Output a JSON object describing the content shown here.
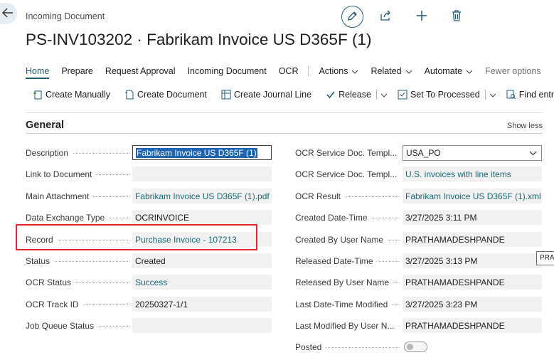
{
  "header": {
    "caption": "Incoming Document",
    "title": "PS-INV103202 · Fabrikam Invoice US D365F (1)"
  },
  "menu": {
    "items": [
      "Home",
      "Prepare",
      "Request Approval",
      "Incoming Document",
      "OCR"
    ],
    "dropdowns": [
      "Actions",
      "Related",
      "Automate"
    ],
    "fewer_options": "Fewer options"
  },
  "actions": {
    "create_manually": "Create Manually",
    "create_document": "Create Document",
    "create_journal_line": "Create Journal Line",
    "release": "Release",
    "set_to_processed": "Set To Processed",
    "find_entries": "Find entries..."
  },
  "section": {
    "title": "General",
    "toggle_label": "Show less"
  },
  "left_fields": [
    {
      "label": "Description",
      "value": "Fabrikam Invoice US D365F (1)"
    },
    {
      "label": "Link to Document",
      "value": ""
    },
    {
      "label": "Main Attachment",
      "value": "Fabrikam Invoice US D365F (1).pdf"
    },
    {
      "label": "Data Exchange Type",
      "value": "OCRINVOICE"
    },
    {
      "label": "Record",
      "value": "Purchase Invoice - 107213"
    },
    {
      "label": "Status",
      "value": "Created"
    },
    {
      "label": "OCR Status",
      "value": "Success"
    },
    {
      "label": "OCR Track ID",
      "value": "20250327-1/1"
    },
    {
      "label": "Job Queue Status",
      "value": ""
    }
  ],
  "right_fields": [
    {
      "label": "OCR Service Doc. Templ...",
      "value": "USA_PO"
    },
    {
      "label": "OCR Service Doc. Templ...",
      "value": "U.S. invoices with line items"
    },
    {
      "label": "OCR Result",
      "value": "Fabrikam Invoice US D365F (1).xml"
    },
    {
      "label": "Created Date-Time",
      "value": "3/27/2025 3:11 PM"
    },
    {
      "label": "Created By User Name",
      "value": "PRATHAMADESHPANDE"
    },
    {
      "label": "Released Date-Time",
      "value": "3/27/2025 3:13 PM"
    },
    {
      "label": "Released By User Name",
      "value": "PRATHAMADESHPANDE"
    },
    {
      "label": "Last Date-Time Modified",
      "value": "3/27/2025 3:23 PM"
    },
    {
      "label": "Last Modified By User N...",
      "value": "PRATHAMADESHPANDE"
    },
    {
      "label": "Posted",
      "value": false
    }
  ],
  "tooltip": "PRA",
  "colors": {
    "accent": "#1f5a78",
    "link": "#1a6b76",
    "highlight": "#e3262c",
    "selection": "#1d64b2"
  }
}
